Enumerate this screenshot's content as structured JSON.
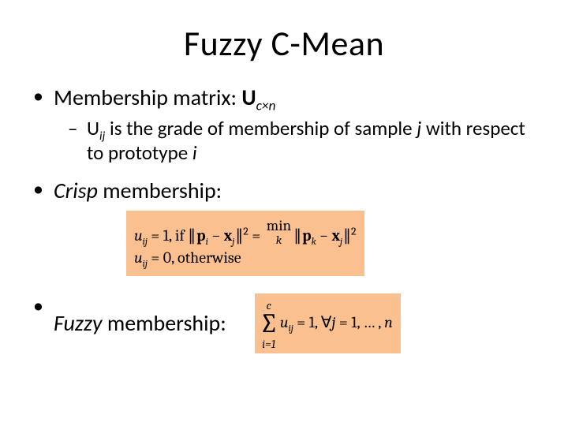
{
  "title": "Fuzzy C-Mean",
  "bullet1": {
    "prefix": "Membership matrix: ",
    "matrixSymbol": "U",
    "matrixSubscript": "c×n",
    "sub": {
      "uSymbol": "U",
      "uSubscript": "ij",
      "tail1": " is the grade of membership of sample ",
      "jSym": "j",
      "tail2": " with respect to prototype ",
      "iSym": "i"
    }
  },
  "bullet2": {
    "emph": "Crisp",
    "tail": " membership:"
  },
  "crispEq": {
    "line1_lhs": "u",
    "line1_sub": "ij",
    "line1_eq": " = 1,  if ",
    "line1_norm1_a": "p",
    "line1_norm1_asub": "i",
    "line1_minus": " − ",
    "line1_norm1_b": "x",
    "line1_norm1_bsub": "j",
    "line1_after1": " = ",
    "line1_min_top": "min",
    "line1_min_bot": "k",
    "line1_norm2_a": "p",
    "line1_norm2_asub": "k",
    "line1_norm2_b": "x",
    "line1_norm2_bsub": "j",
    "sqExp": "2",
    "line2_lhs": "u",
    "line2_sub": "ij",
    "line2_tail": " = 0,  otherwise"
  },
  "bullet3": {
    "emph": "Fuzzy",
    "tail": " membership:"
  },
  "fuzzyEq": {
    "sum_top": "c",
    "sum_sym": "∑",
    "sum_bot": "i=1",
    "u": "u",
    "usub": "ij",
    "eq1": " = 1, ∀",
    "j": "j",
    "tail": " = 1, … , ",
    "n": "n"
  },
  "chart_data": null
}
